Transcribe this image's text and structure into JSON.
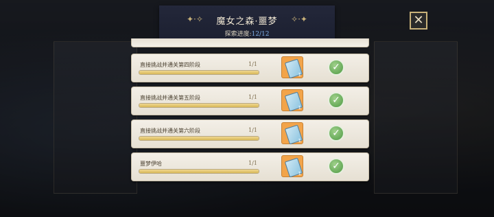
{
  "header": {
    "title": "魔女之森·噩梦",
    "progress_label": "探索进度:",
    "progress_value": "12/12"
  },
  "icons": {
    "close": "close-x-icon",
    "reward": "ticket-icon",
    "completed": "check-icon"
  },
  "quests": [
    {
      "label": "直接挑战并通关第四阶段",
      "count": "1/1",
      "progress": 1.0,
      "reward_qty": "1",
      "completed": true
    },
    {
      "label": "直接挑战并通关第五阶段",
      "count": "1/1",
      "progress": 1.0,
      "reward_qty": "1",
      "completed": true
    },
    {
      "label": "直接挑战并通关第六阶段",
      "count": "1/1",
      "progress": 1.0,
      "reward_qty": "1",
      "completed": true
    },
    {
      "label": "噩梦伊哈",
      "count": "1/1",
      "progress": 1.0,
      "reward_qty": "1",
      "completed": true
    }
  ],
  "colors": {
    "accent_gold": "#c9b27a",
    "progress_blue": "#7fb0e8",
    "ticket_orange": "#f2a44a",
    "check_green": "#4f9a44"
  }
}
